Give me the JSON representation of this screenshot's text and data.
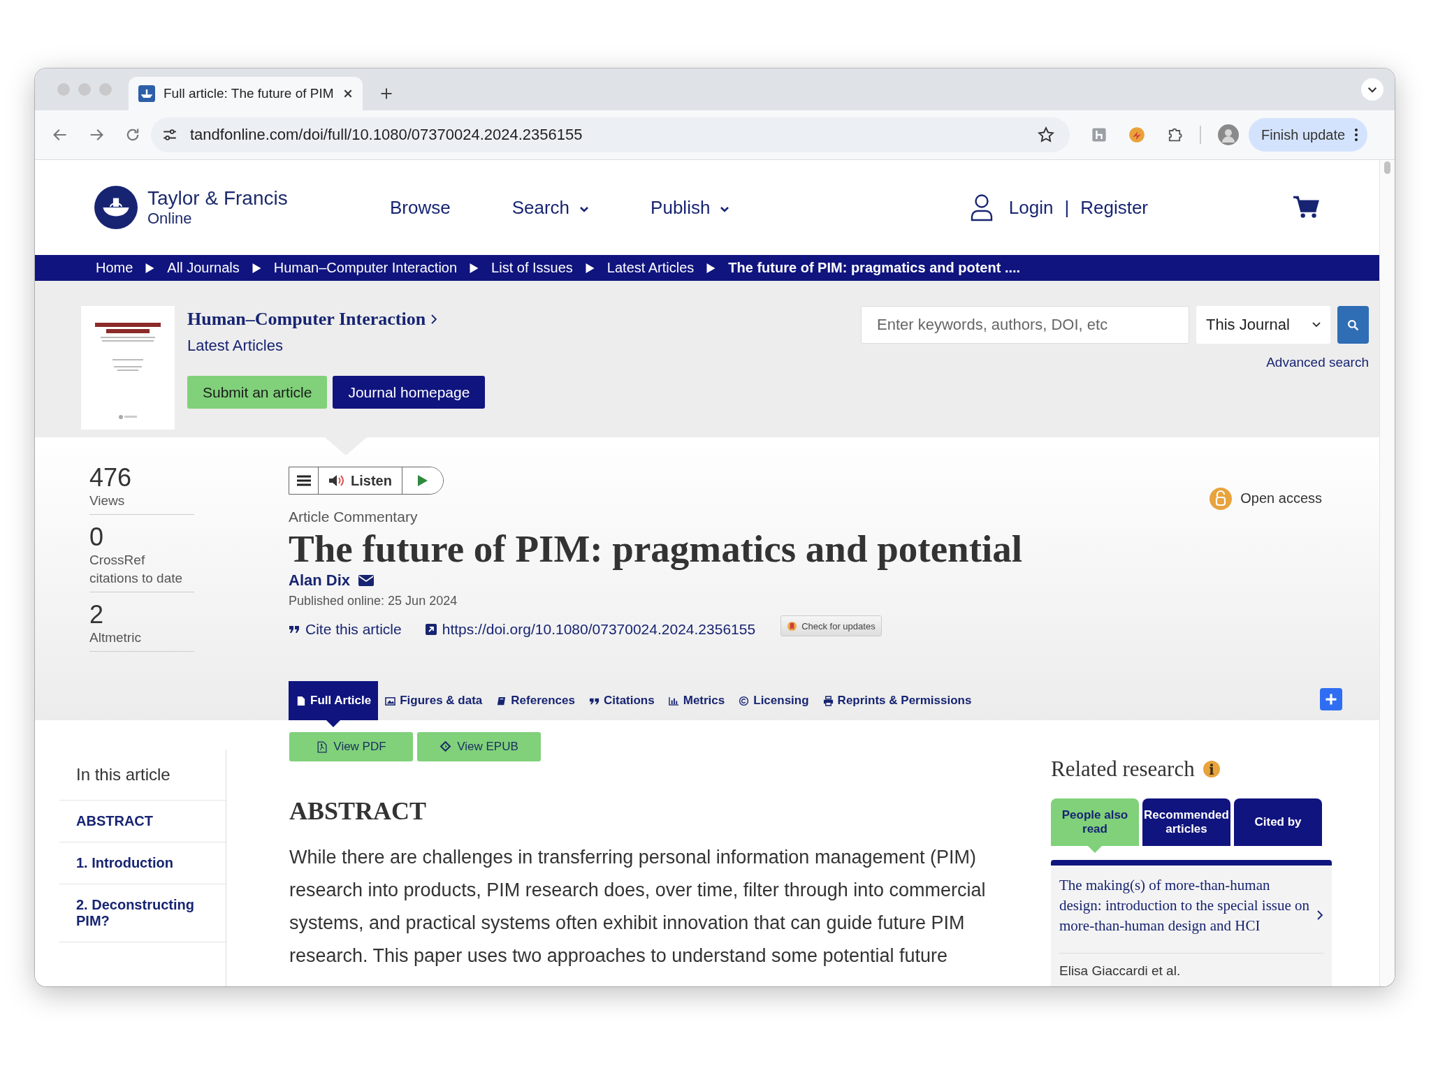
{
  "browser": {
    "tab_title": "Full article: The future of PIM",
    "url": "tandfonline.com/doi/full/10.1080/07370024.2024.2356155",
    "update_button": "Finish update"
  },
  "header": {
    "logo_name": "Taylor & Francis",
    "logo_sub": "Online",
    "login": "Login",
    "separator": "|",
    "register": "Register",
    "nav": [
      {
        "label": "Browse",
        "dropdown": false
      },
      {
        "label": "Search",
        "dropdown": true
      },
      {
        "label": "Publish",
        "dropdown": true
      }
    ]
  },
  "breadcrumb": [
    "Home",
    "All Journals",
    "Human–Computer Interaction",
    "List of Issues",
    "Latest Articles",
    "The future of PIM: pragmatics and potent ...."
  ],
  "journal": {
    "title": "Human–Computer Interaction",
    "subtitle": "Latest Articles",
    "buttons": [
      {
        "label": "Submit an article",
        "kind": "primary"
      },
      {
        "label": "Journal homepage",
        "kind": "secondary"
      }
    ],
    "search": {
      "placeholder": "Enter keywords, authors, DOI, etc",
      "scope": "This Journal",
      "advanced": "Advanced search"
    }
  },
  "metrics": [
    {
      "value": "476",
      "label": "Views"
    },
    {
      "value": "0",
      "label": "CrossRef citations to date"
    },
    {
      "value": "2",
      "label": "Altmetric"
    }
  ],
  "player": {
    "label": "Listen"
  },
  "article": {
    "type": "Article Commentary",
    "title": "The future of PIM: pragmatics and potential",
    "author": "Alan Dix",
    "published": "Published online: 25 Jun 2024",
    "cite": "Cite this article",
    "doi": "https://doi.org/10.1080/07370024.2024.2356155",
    "updates": "Check for updates",
    "access": "Open access"
  },
  "tabs": [
    {
      "label": "Full Article",
      "selected": true
    },
    {
      "label": "Figures & data",
      "selected": false
    },
    {
      "label": "References",
      "selected": false
    },
    {
      "label": "Citations",
      "selected": false
    },
    {
      "label": "Metrics",
      "selected": false
    },
    {
      "label": "Licensing",
      "selected": false
    },
    {
      "label": "Reprints & Permissions",
      "selected": false
    }
  ],
  "downloads": [
    "View PDF",
    "View EPUB"
  ],
  "toc": {
    "title": "In this article",
    "items": [
      "ABSTRACT",
      "1. Introduction",
      "2. Deconstructing PIM?"
    ]
  },
  "abstract": {
    "heading": "ABSTRACT",
    "text": "While there are challenges in transferring personal information management (PIM) research into products, PIM research does, over time, filter through into commercial systems, and practical systems often exhibit innovation that can guide future PIM research. This paper uses two approaches to understand some potential future"
  },
  "related": {
    "title": "Related research",
    "tabs": [
      {
        "label": "People also read",
        "selected": true
      },
      {
        "label": "Recommended articles",
        "selected": false
      },
      {
        "label": "Cited by",
        "selected": false
      }
    ],
    "items": [
      {
        "title": "The making(s) of more-than-human design: introduction to the special issue on more-than-human design and HCI",
        "authors": "Elisa Giaccardi et al."
      }
    ]
  }
}
